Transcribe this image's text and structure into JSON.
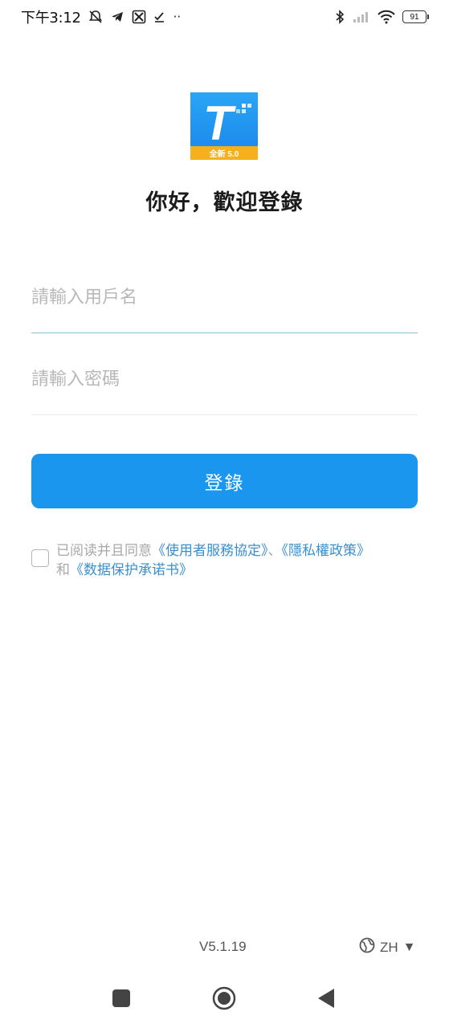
{
  "status_bar": {
    "time": "下午3:12",
    "battery": "91",
    "more": "··"
  },
  "app": {
    "logo_letter": "T",
    "logo_badge": "全新 5.0"
  },
  "welcome": {
    "title": "你好，歡迎登錄"
  },
  "login_form": {
    "username_placeholder": "請輸入用戶名",
    "username_value": "",
    "password_placeholder": "請輸入密碼",
    "password_value": "",
    "login_label": "登錄"
  },
  "agreement": {
    "prefix": "已阅读并且同意",
    "link_terms": "《使用者服務協定》",
    "separator": "、",
    "link_privacy": "《隱私權政策》",
    "conjunction": "和",
    "link_data": "《数据保护承诺书》"
  },
  "footer": {
    "version": "V5.1.19",
    "language": "ZH",
    "language_arrow": "▼"
  },
  "colors": {
    "primary": "#1b96ee",
    "link": "#3a8fd0",
    "logo_badge": "#f7b01c"
  }
}
